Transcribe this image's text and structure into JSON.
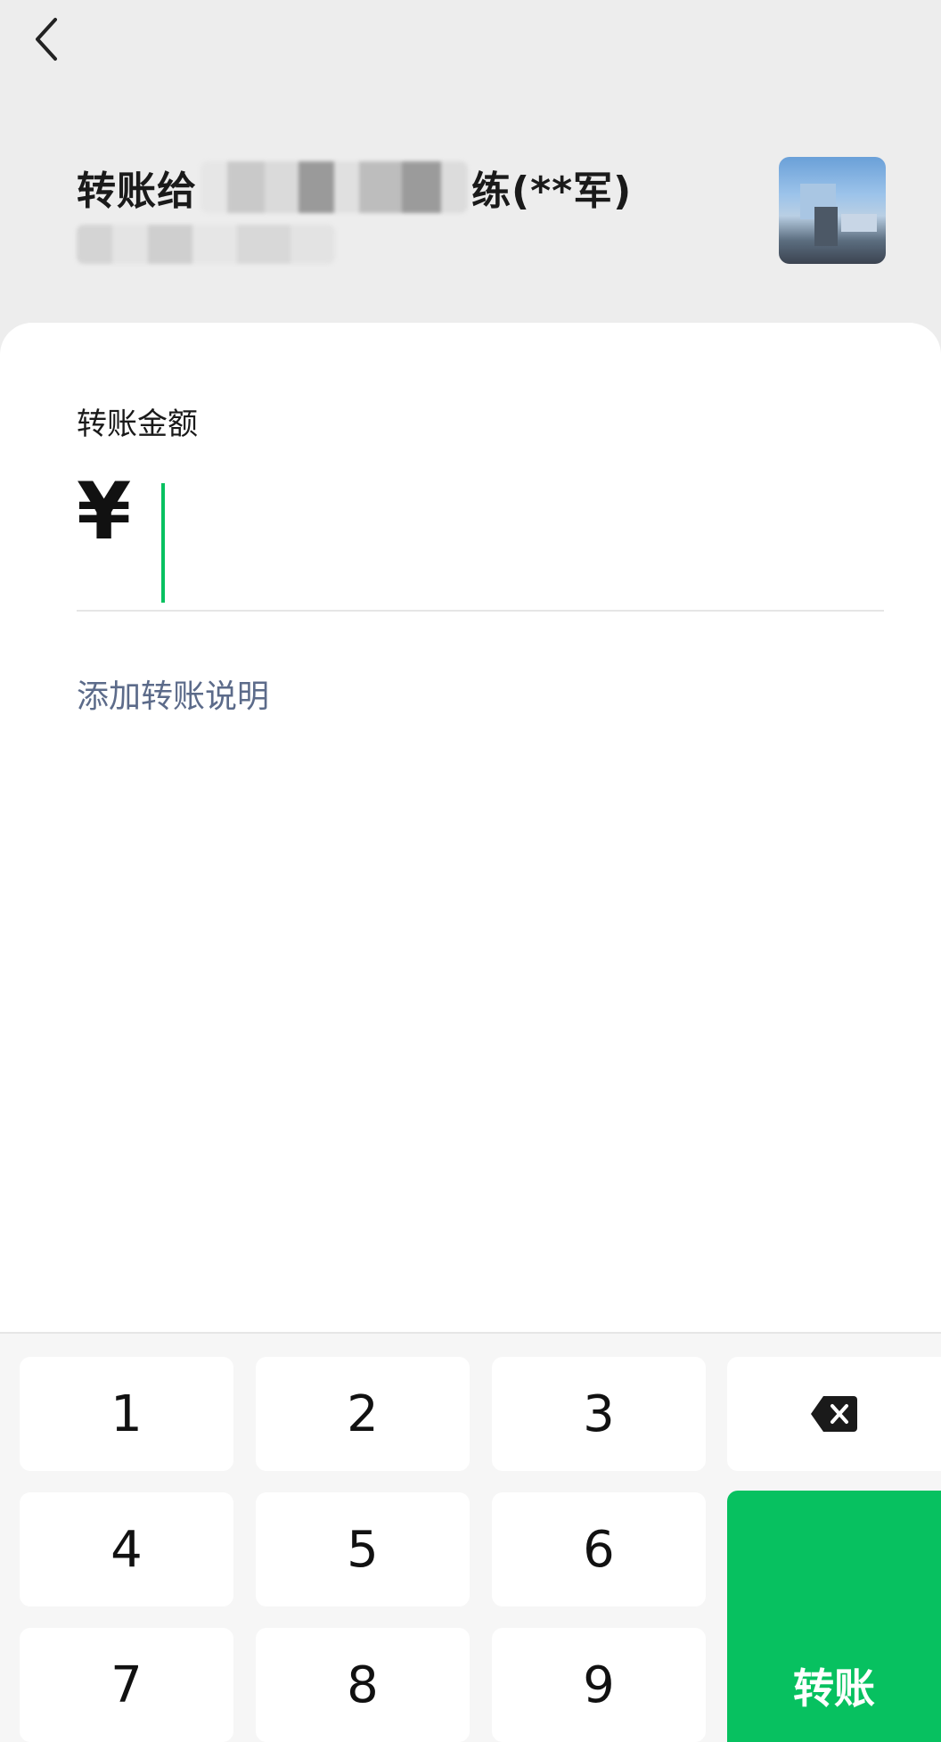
{
  "header": {
    "title_prefix": "转账给",
    "title_suffix": "练(**军)"
  },
  "amount": {
    "label": "转账金额",
    "currency_symbol": "¥",
    "value": ""
  },
  "add_note_label": "添加转账说明",
  "keypad": {
    "keys": [
      "1",
      "2",
      "3",
      "4",
      "5",
      "6",
      "7",
      "8",
      "9"
    ],
    "delete_icon": "backspace-icon",
    "confirm_label": "转账",
    "confirm_color": "#07c160"
  },
  "colors": {
    "accent": "#07c160",
    "link": "#5c6b8a",
    "background": "#ededed"
  }
}
